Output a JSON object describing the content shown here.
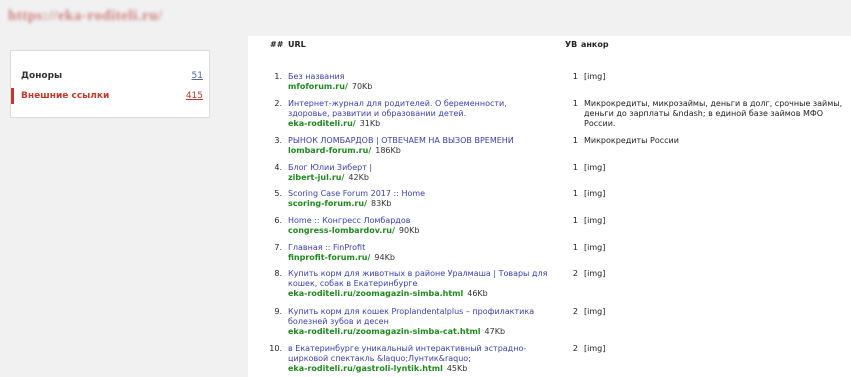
{
  "site_title": "https://eka-roditeli.ru/",
  "sidebar": {
    "items": [
      {
        "label": "Доноры",
        "count": "51"
      },
      {
        "label": "Внешние ссылки",
        "count": "415"
      }
    ]
  },
  "table": {
    "headers": {
      "num": "##",
      "url": "URL",
      "uv": "УВ",
      "anchor": "анкор"
    },
    "rows": [
      {
        "num": "1.",
        "title": "Без названия",
        "domain": "mfoforum.ru/",
        "size": "70Kb",
        "uv": "1",
        "anchor": "[img]"
      },
      {
        "num": "2.",
        "title": "Интернет-журнал для родителей. О беременности, здоровье, развитии и образовании детей.",
        "domain": "eka-roditeli.ru/",
        "size": "31Kb",
        "uv": "1",
        "anchor": "Микрокредиты, микрозаймы, деньги в долг, срочные займы, деньги до зарплаты &ndash; в единой базе займов МФО России."
      },
      {
        "num": "3.",
        "title": "РЫНОК ЛОМБАРДОВ | ОТВЕЧАЕМ НА ВЫЗОВ ВРЕМЕНИ",
        "domain": "lombard-forum.ru/",
        "size": "186Kb",
        "uv": "1",
        "anchor": "Микрокредиты России"
      },
      {
        "num": "4.",
        "title": "Блог Юлии Зиберт |",
        "domain": "zibert-jul.ru/",
        "size": "42Kb",
        "uv": "1",
        "anchor": "[img]"
      },
      {
        "num": "5.",
        "title": "Scoring Case Forum 2017 :: Home",
        "domain": "scoring-forum.ru/",
        "size": "83Kb",
        "uv": "1",
        "anchor": "[img]"
      },
      {
        "num": "6.",
        "title": "Home :: Конгресс Ломбардов",
        "domain": "congress-lombardov.ru/",
        "size": "90Kb",
        "uv": "1",
        "anchor": "[img]"
      },
      {
        "num": "7.",
        "title": "Главная :: FinProfit",
        "domain": "finprofit-forum.ru/",
        "size": "94Kb",
        "uv": "1",
        "anchor": "[img]"
      },
      {
        "num": "8.",
        "title": "Купить корм для животных в районе Уралмаша | Товары для кошек, собак в Екатеринбурге",
        "domain": "eka-roditeli.ru/zoomagazin-simba.html",
        "size": "46Kb",
        "uv": "2",
        "anchor": "[img]"
      },
      {
        "num": "9.",
        "title": "Купить корм для кошек Proplandentalplus – профилактика болезней зубов и десен",
        "domain": "eka-roditeli.ru/zoomagazin-simba-cat.html",
        "size": "47Kb",
        "uv": "2",
        "anchor": "[img]"
      },
      {
        "num": "10.",
        "title": "в Екатеринбурге уникальный интерактивный эстрадно-цирковой спектакль &laquo;Лунтик&raquo;",
        "domain": "eka-roditeli.ru/gastroli-lyntik.html",
        "size": "45Kb",
        "uv": "2",
        "anchor": "[img]"
      }
    ]
  }
}
